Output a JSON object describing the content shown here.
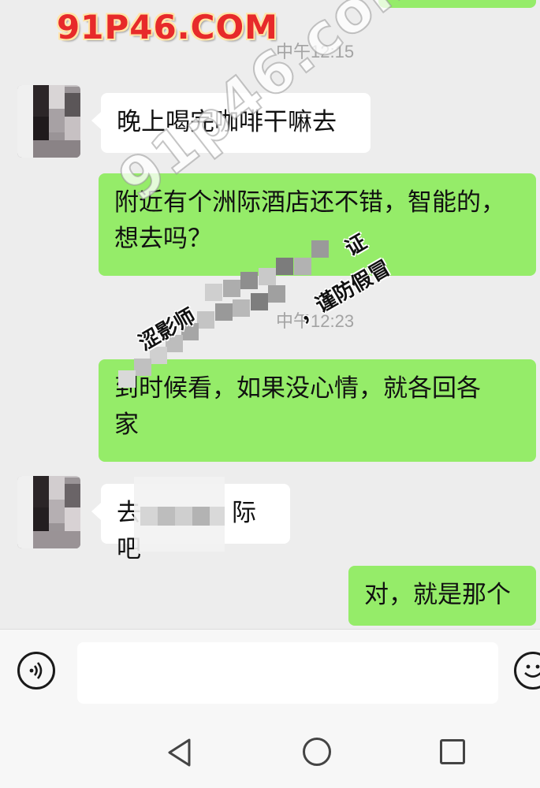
{
  "watermark": {
    "title": "91P46.COM",
    "diagonal": "91p46.com",
    "stamp_left": "涩影师",
    "stamp_right_top": "证",
    "stamp_right": "，谨防假冒"
  },
  "messages": [
    {
      "type": "time",
      "text": "中午12:15"
    },
    {
      "type": "incoming",
      "text": "晚上喝完咖啡干嘛去"
    },
    {
      "type": "outgoing",
      "line1": "附近有个洲际酒店还不错，智能的，",
      "line2": "想去吗？"
    },
    {
      "type": "time",
      "text": "中午12:23"
    },
    {
      "type": "outgoing",
      "line1": "到时候看，如果没心情，就各回各",
      "line2": "家"
    },
    {
      "type": "incoming",
      "prefix": "去",
      "suffix": "际吧"
    },
    {
      "type": "outgoing",
      "text": "对，就是那个"
    }
  ],
  "input_bar": {
    "voice_icon": "voice-icon",
    "emoji_icon": "emoji-icon",
    "text_value": ""
  },
  "nav": {
    "back": "back-icon",
    "home": "home-icon",
    "recent": "recent-apps-icon"
  },
  "colors": {
    "outgoing_bubble": "#95ec69",
    "incoming_bubble": "#ffffff",
    "background": "#ededed",
    "watermark": "#e72a2a"
  }
}
